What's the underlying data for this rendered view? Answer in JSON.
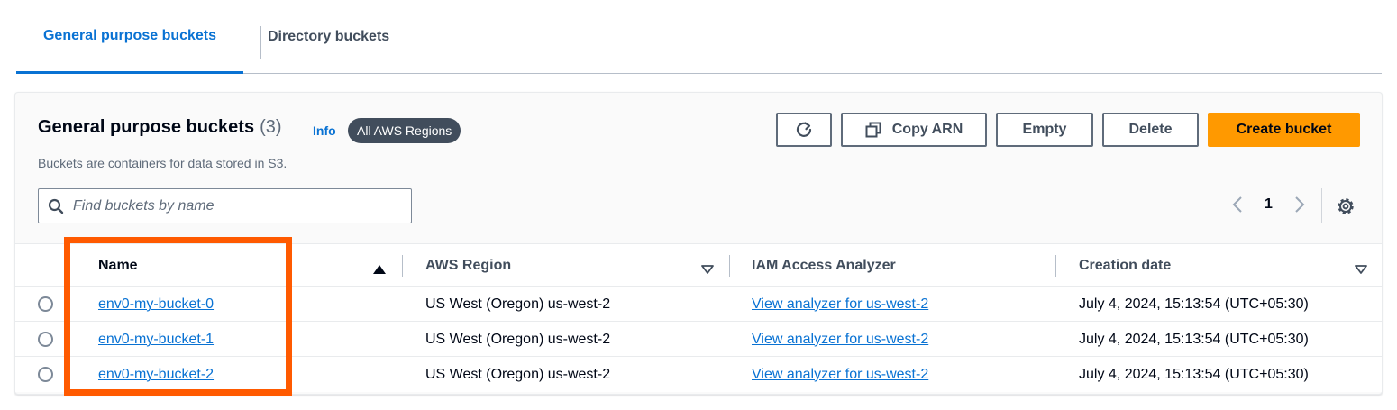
{
  "tabs": [
    {
      "label": "General purpose buckets",
      "active": true
    },
    {
      "label": "Directory buckets",
      "active": false
    }
  ],
  "panel": {
    "title": "General purpose buckets",
    "count": "(3)",
    "info": "Info",
    "region_badge": "All AWS Regions",
    "description": "Buckets are containers for data stored in S3."
  },
  "actions": {
    "refresh_icon": "refresh-icon",
    "copy_arn": "Copy ARN",
    "empty": "Empty",
    "delete": "Delete",
    "create": "Create bucket"
  },
  "search": {
    "placeholder": "Find buckets by name"
  },
  "pagination": {
    "page": "1"
  },
  "table": {
    "columns": [
      "Name",
      "AWS Region",
      "IAM Access Analyzer",
      "Creation date"
    ],
    "rows": [
      {
        "name": "env0-my-bucket-0",
        "region": "US West (Oregon) us-west-2",
        "analyzer": "View analyzer for us-west-2",
        "created": "July 4, 2024, 15:13:54 (UTC+05:30)"
      },
      {
        "name": "env0-my-bucket-1",
        "region": "US West (Oregon) us-west-2",
        "analyzer": "View analyzer for us-west-2",
        "created": "July 4, 2024, 15:13:54 (UTC+05:30)"
      },
      {
        "name": "env0-my-bucket-2",
        "region": "US West (Oregon) us-west-2",
        "analyzer": "View analyzer for us-west-2",
        "created": "July 4, 2024, 15:13:54 (UTC+05:30)"
      }
    ]
  },
  "colors": {
    "accent": "#0972d3",
    "primary_button": "#ff9900",
    "highlight": "#ff5a00"
  }
}
